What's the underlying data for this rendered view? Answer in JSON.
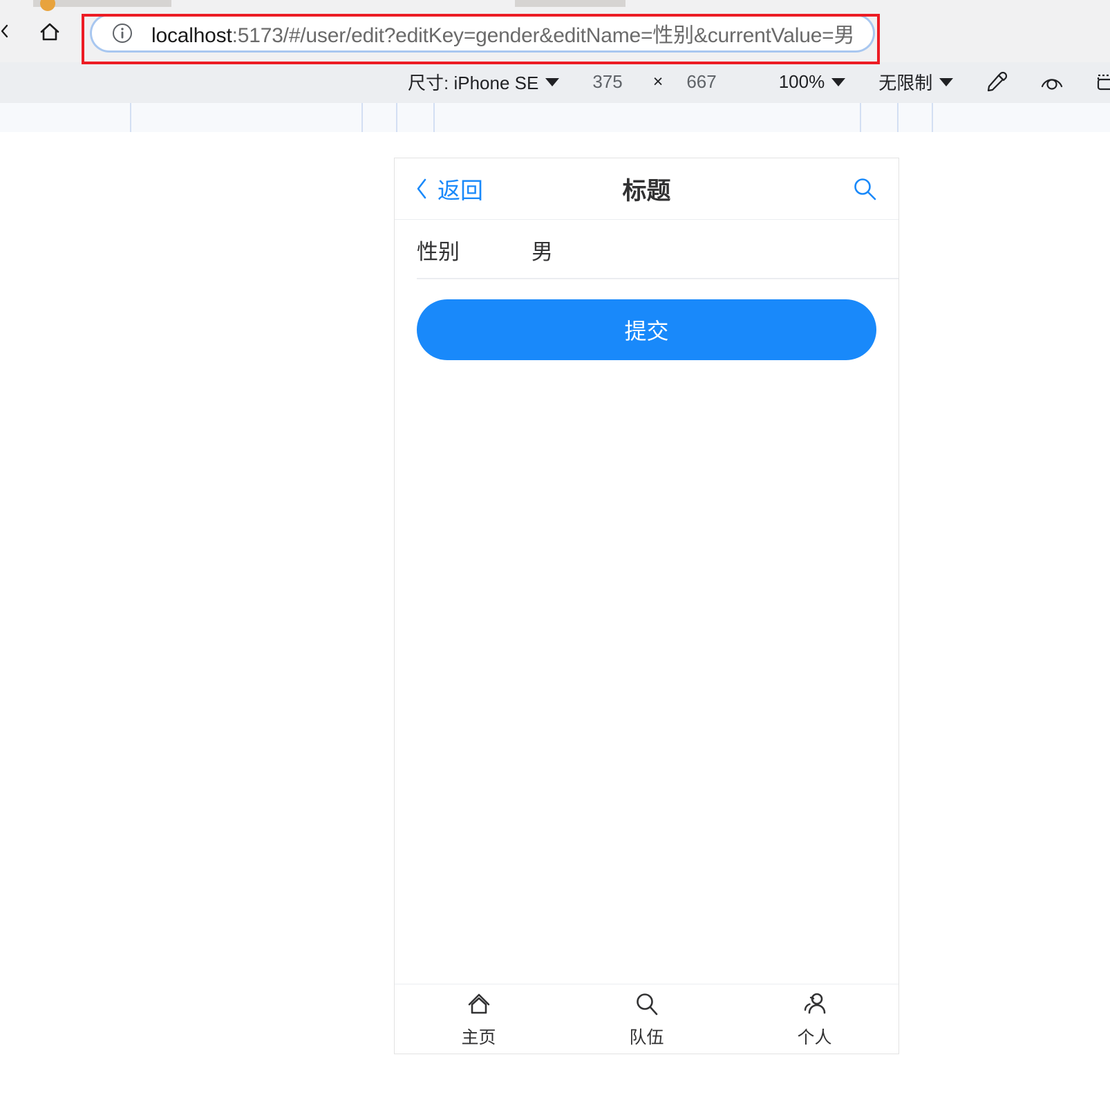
{
  "browser": {
    "url_full": "localhost:5173/#/user/edit?editKey=gender&editName=性别&currentValue=男",
    "url_host": "localhost",
    "url_rest": ":5173/#/user/edit?editKey=gender&editName=性别&currentValue=男",
    "info_icon": "info-circle-icon",
    "home_icon": "home-icon",
    "back_icon": "nav-back-arrow-icon",
    "highlight_color": "#ec1c24",
    "focus_ring_color": "#a8c7f0"
  },
  "device_toolbar": {
    "size_label": "尺寸: iPhone SE",
    "width": "375",
    "times": "×",
    "height": "667",
    "zoom": "100%",
    "throttle": "无限制",
    "icons": [
      {
        "name": "eyedropper-icon"
      },
      {
        "name": "eye-icon"
      },
      {
        "name": "rotate-device-icon"
      }
    ]
  },
  "app": {
    "navbar": {
      "back_label": "返回",
      "back_icon": "chevron-left-icon",
      "title": "标题",
      "search_icon": "search-icon",
      "accent_color": "#1989fa"
    },
    "form": {
      "field": {
        "label": "性别",
        "value": "男"
      },
      "submit_label": "提交",
      "submit_color": "#1989fa"
    },
    "tabbar": {
      "items": [
        {
          "icon": "home-icon",
          "label": "主页"
        },
        {
          "icon": "search-icon",
          "label": "队伍"
        },
        {
          "icon": "users-icon",
          "label": "个人"
        }
      ]
    }
  }
}
